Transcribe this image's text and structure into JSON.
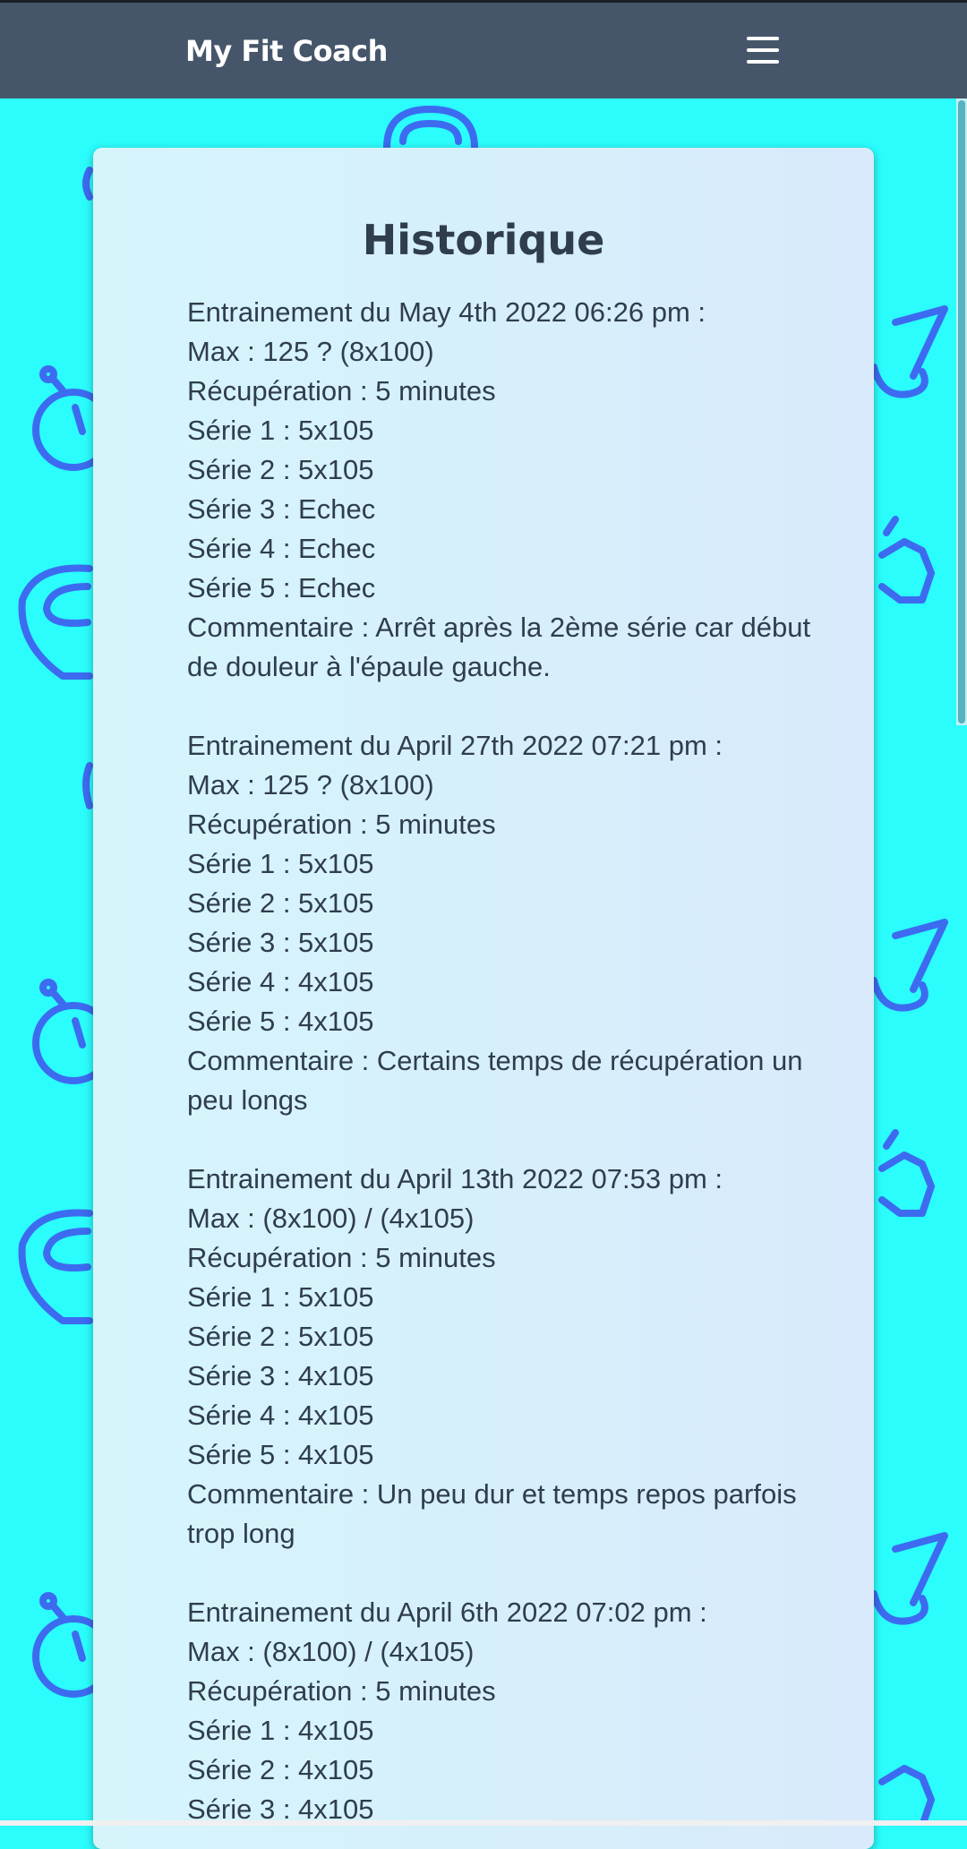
{
  "app": {
    "brand": "My Fit Coach"
  },
  "colors": {
    "navbar": "#46566a",
    "background": "#2bfdfd",
    "icon_pattern": "#3d6bf0",
    "card": "#d8eefb",
    "text": "#2f3d4c"
  },
  "icons": {
    "menu": "hamburger-menu-icon",
    "pattern": [
      "kettlebell-icon",
      "stopwatch-icon",
      "dumbbell-icon",
      "bench-icon"
    ]
  },
  "page": {
    "title": "Historique"
  },
  "entries": [
    {
      "header": "Entrainement du May 4th 2022 06:26 pm :",
      "max": "Max : 125 ? (8x100)",
      "recovery": "Récupération : 5 minutes",
      "series": [
        "Série 1 : 5x105",
        "Série 2 : 5x105",
        "Série 3 : Echec",
        "Série 4 : Echec",
        "Série 5 : Echec"
      ],
      "comment": "Commentaire : Arrêt après la 2ème série car début de douleur à l'épaule gauche."
    },
    {
      "header": "Entrainement du April 27th 2022 07:21 pm :",
      "max": "Max : 125 ? (8x100)",
      "recovery": "Récupération : 5 minutes",
      "series": [
        "Série 1 : 5x105",
        "Série 2 : 5x105",
        "Série 3 : 5x105",
        "Série 4 : 4x105",
        "Série 5 : 4x105"
      ],
      "comment": "Commentaire : Certains temps de récupération un peu longs"
    },
    {
      "header": "Entrainement du April 13th 2022 07:53 pm :",
      "max": "Max : (8x100) / (4x105)",
      "recovery": "Récupération : 5 minutes",
      "series": [
        "Série 1 : 5x105",
        "Série 2 : 5x105",
        "Série 3 : 4x105",
        "Série 4 : 4x105",
        "Série 5 : 4x105"
      ],
      "comment": "Commentaire : Un peu dur et temps repos parfois trop long"
    },
    {
      "header": "Entrainement du April 6th 2022 07:02 pm :",
      "max": "Max : (8x100) / (4x105)",
      "recovery": "Récupération : 5 minutes",
      "series": [
        "Série 1 : 4x105",
        "Série 2 : 4x105",
        "Série 3 : 4x105"
      ],
      "comment": ""
    }
  ]
}
